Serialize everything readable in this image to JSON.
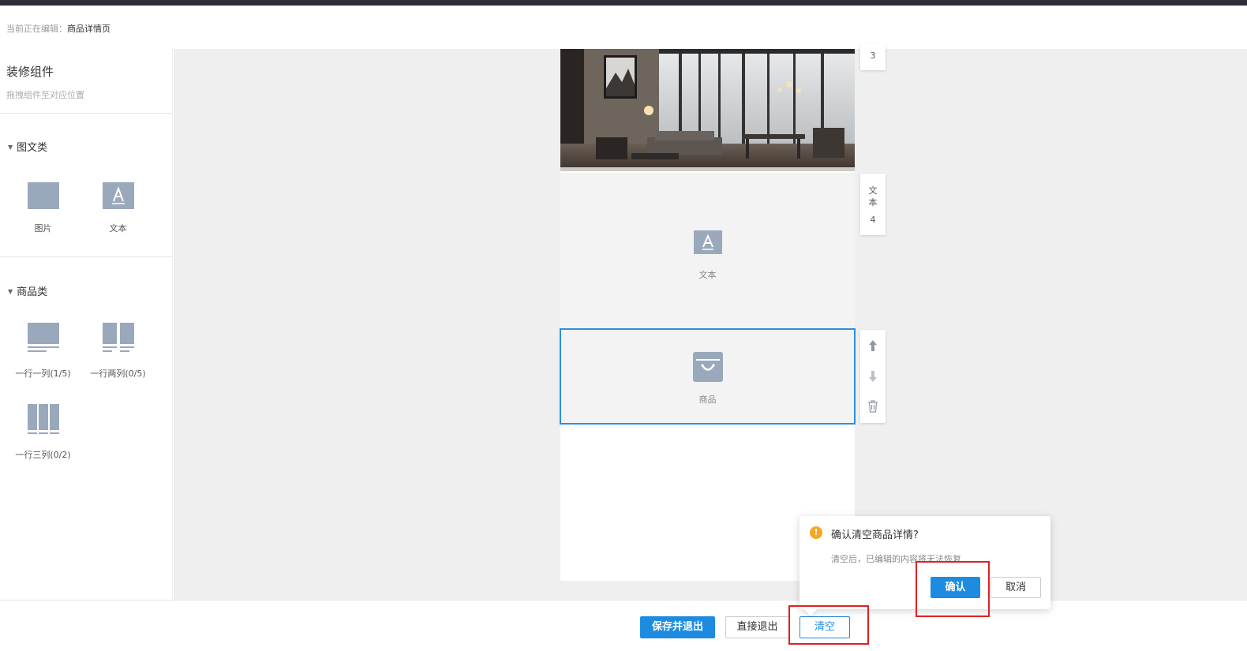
{
  "header": {
    "editing_prefix": "当前正在编辑：",
    "editing_page": "商品详情页"
  },
  "sidebar": {
    "title": "装修组件",
    "subtitle": "拖拽组件至对应位置",
    "categories": [
      {
        "name": "图文类",
        "items": [
          {
            "label": "图片",
            "icon": "image-icon"
          },
          {
            "label": "文本",
            "icon": "text-icon"
          }
        ]
      },
      {
        "name": "商品类",
        "items": [
          {
            "label": "一行一列(1/5)",
            "icon": "one-column-icon"
          },
          {
            "label": "一行两列(0/5)",
            "icon": "two-column-icon"
          },
          {
            "label": "一行三列(0/2)",
            "icon": "three-column-icon"
          }
        ]
      }
    ]
  },
  "canvas": {
    "image_tab_index": "3",
    "text_block": {
      "label": "文本",
      "tab_label": "文本",
      "tab_index": "4"
    },
    "goods_block": {
      "label": "商品"
    }
  },
  "popover": {
    "title": "确认清空商品详情?",
    "message": "清空后，已编辑的内容将无法恢复",
    "confirm_label": "确认",
    "cancel_label": "取消"
  },
  "footer": {
    "save_exit_label": "保存并退出",
    "exit_label": "直接退出",
    "clear_label": "清空"
  },
  "colors": {
    "primary": "#1d8ce0",
    "warning": "#f5a623",
    "highlight_box": "#e02020",
    "icon_gray": "#9aa8bb"
  }
}
